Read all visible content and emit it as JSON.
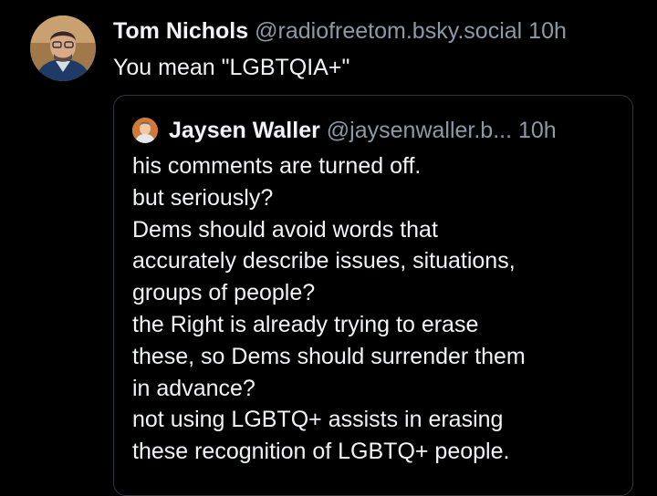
{
  "post": {
    "author_display_name": "Tom Nichols",
    "author_handle": "@radiofreetom.bsky.social",
    "timestamp": "10h",
    "text": "You mean \"LGBTQIA+\"",
    "avatar_icon": "person-photo-avatar"
  },
  "quote": {
    "author_display_name": "Jaysen Waller",
    "author_handle": "@jaysenwaller.b...",
    "timestamp": "10h",
    "avatar_icon": "person-photo-avatar",
    "lines": [
      "his comments are turned off.",
      "but seriously?",
      "Dems should avoid words that",
      "accurately describe issues, situations,",
      "groups of people?",
      "the Right is already trying to erase",
      "these, so Dems should surrender them",
      "in advance?",
      "not using LGBTQ+ assists in erasing",
      "these recognition of LGBTQ+ people."
    ]
  },
  "colors": {
    "background": "#000000",
    "text_primary": "#f1f3f5",
    "text_secondary": "#8d99a6",
    "card_border": "#2e3640"
  }
}
